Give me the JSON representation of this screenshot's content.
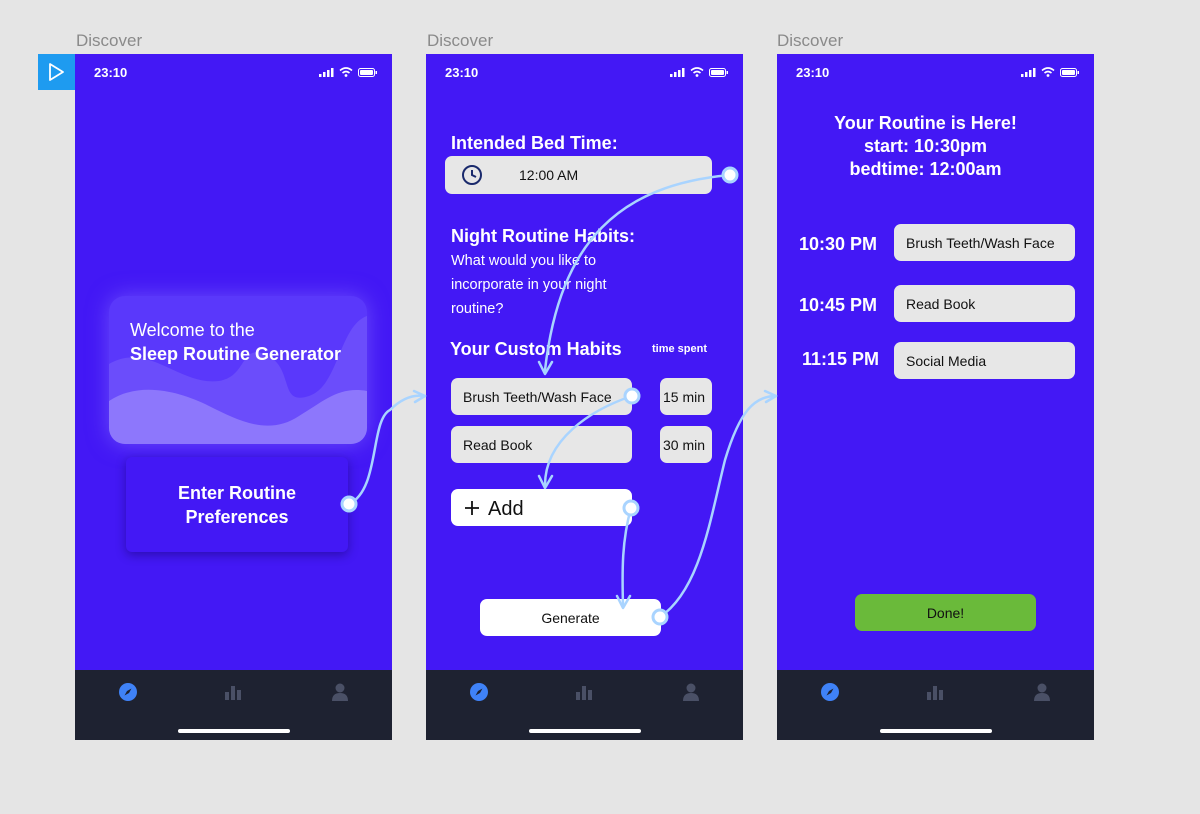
{
  "frames": [
    {
      "label": "Discover"
    },
    {
      "label": "Discover"
    },
    {
      "label": "Discover"
    }
  ],
  "status": {
    "time": "23:10"
  },
  "tabbar": {
    "icons": [
      "compass-icon",
      "bar-chart-icon",
      "person-icon"
    ],
    "active_color": "#3f82f7",
    "inactive_color": "#4a5066"
  },
  "screen1": {
    "welcome_line1": "Welcome to the",
    "welcome_line2": "Sleep Routine Generator",
    "enter_button": "Enter Routine Preferences"
  },
  "screen2": {
    "bedtime_heading": "Intended Bed Time:",
    "bedtime_value": "12:00 AM",
    "habits_heading": "Night Routine Habits:",
    "habits_prompt_1": "What would you like to",
    "habits_prompt_2": "incorporate in your night",
    "habits_prompt_3": "routine?",
    "custom_heading": "Your Custom Habits",
    "time_spent_header": "time spent",
    "habits": [
      {
        "name": "Brush Teeth/Wash Face",
        "time": "15 min"
      },
      {
        "name": "Read Book",
        "time": "30 min"
      }
    ],
    "add_label": "Add",
    "generate_label": "Generate"
  },
  "screen3": {
    "title_1": "Your Routine is Here!",
    "title_2": "start: 10:30pm",
    "title_3": "bedtime: 12:00am",
    "schedule": [
      {
        "time": "10:30 PM",
        "task": "Brush Teeth/Wash Face"
      },
      {
        "time": "10:45 PM",
        "task": "Read Book"
      },
      {
        "time": "11:15 PM",
        "task": "Social Media"
      }
    ],
    "done_label": "Done!"
  },
  "colors": {
    "screen_bg": "#4318f5",
    "canvas_bg": "#e5e5e5",
    "done_green": "#6aba3a",
    "prototype_link": "#a9d4ff",
    "play_button": "#1e9bf0"
  }
}
